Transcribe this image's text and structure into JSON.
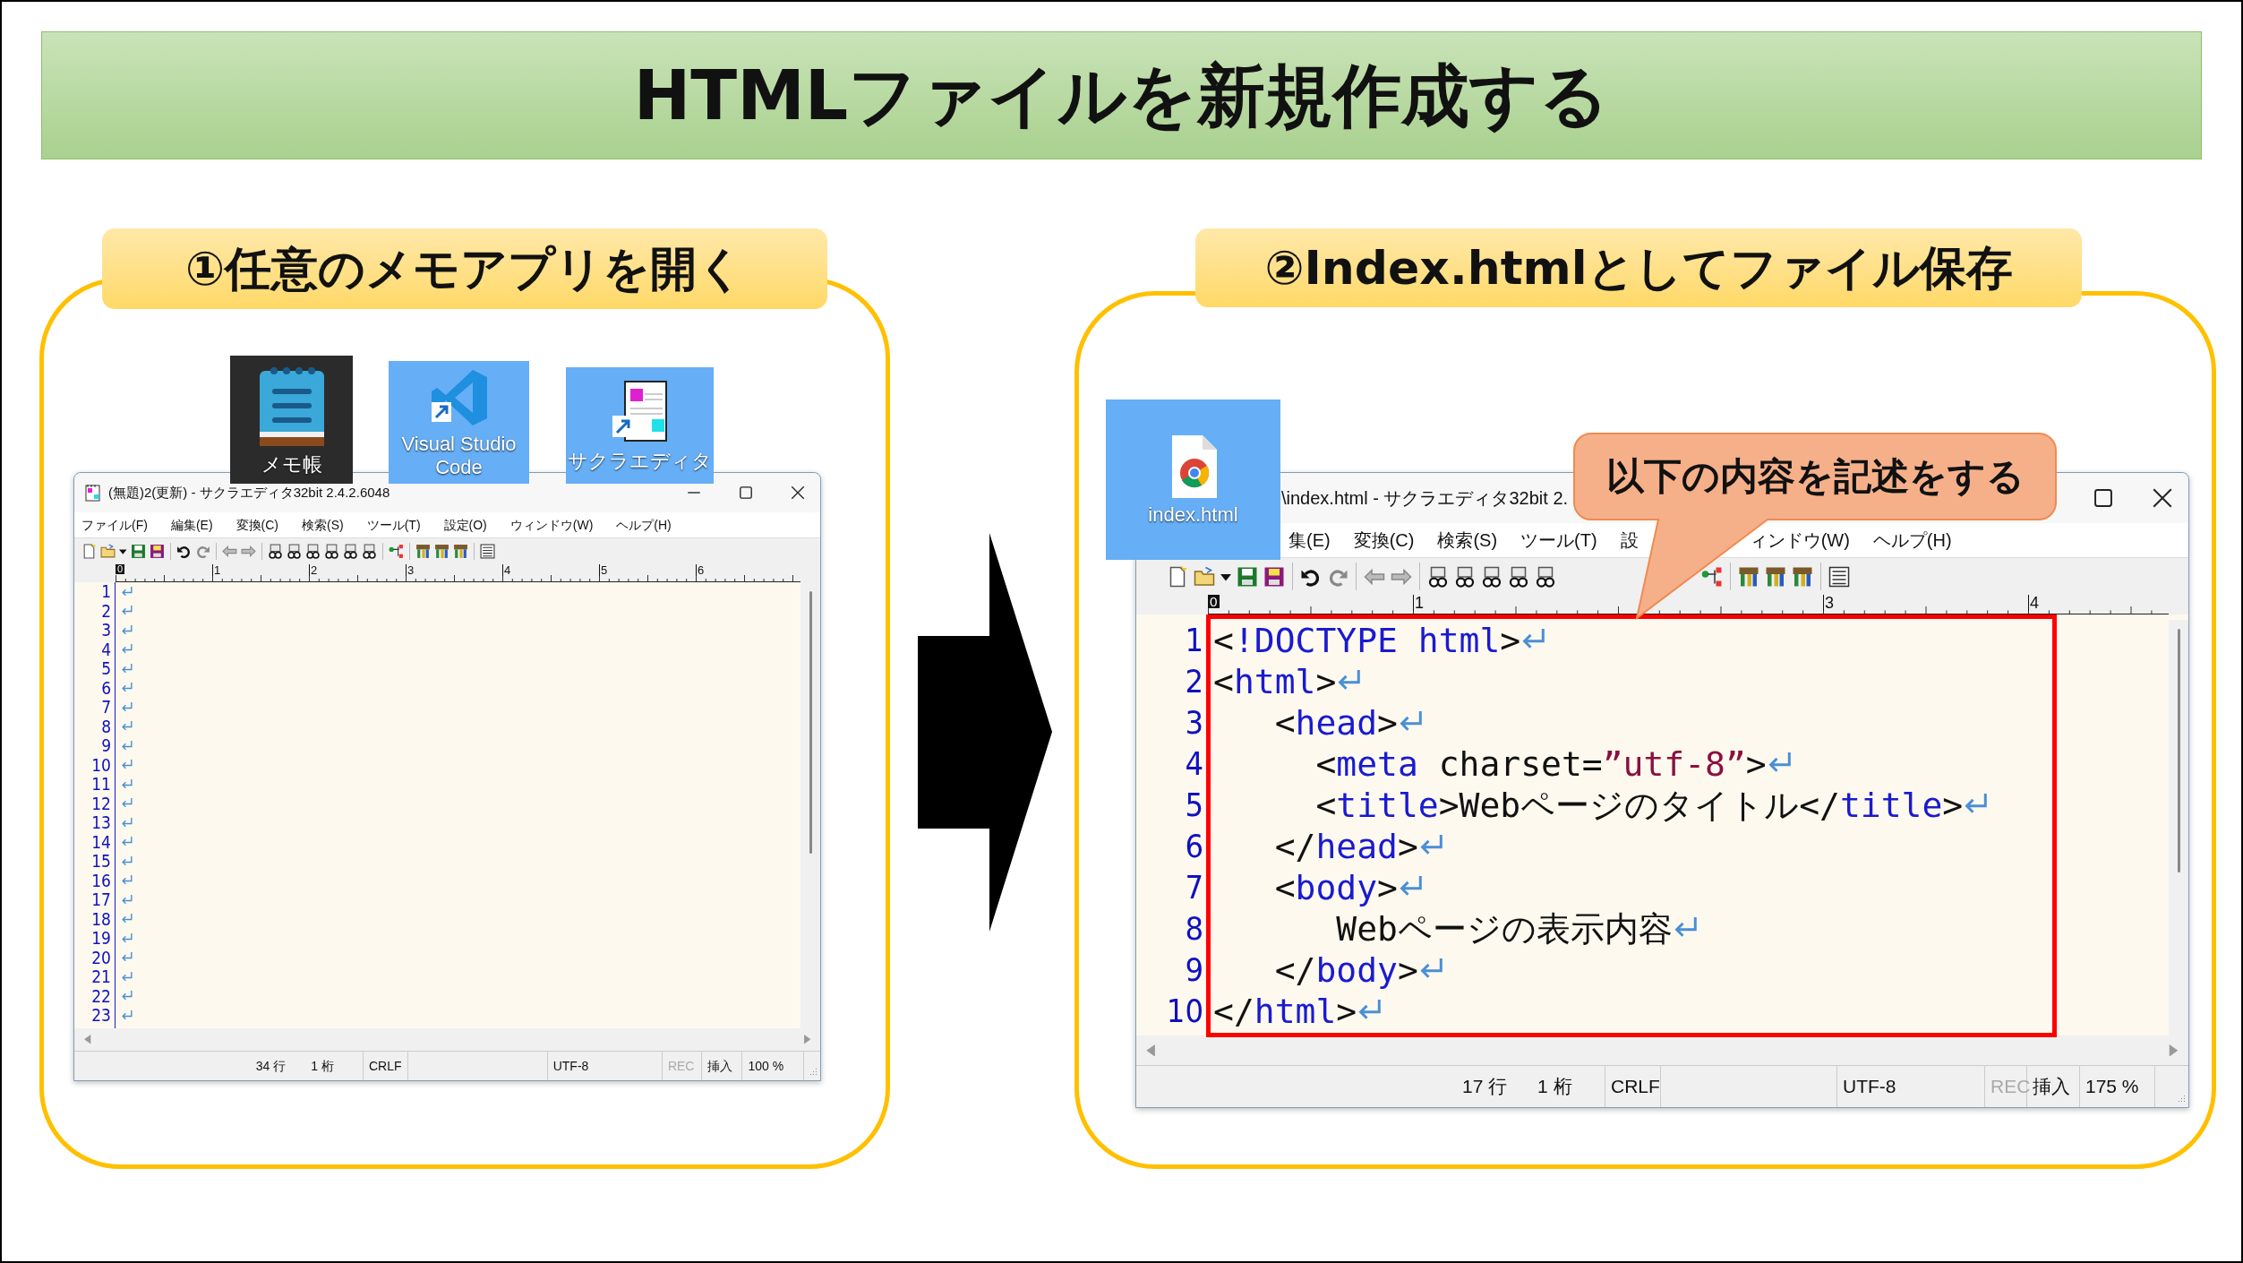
{
  "title": "HTMLファイルを新規作成する",
  "steps": [
    {
      "label": "①任意のメモアプリを開く",
      "desktop_icons": [
        {
          "kind": "notepad",
          "label": "メモ帳"
        },
        {
          "kind": "vscode",
          "label": "Visual Studio Code"
        },
        {
          "kind": "sakura",
          "label": "サクラエディタ"
        }
      ],
      "editor": {
        "title_icon": true,
        "title": "(無題)2(更新) - サクラエディタ32bit 2.4.2.6048",
        "window_buttons": [
          {
            "kind": "minimize"
          },
          {
            "kind": "maximize"
          },
          {
            "kind": "close"
          }
        ],
        "menu": [
          "ファイル(F)",
          "編集(E)",
          "変換(C)",
          "検索(S)",
          "ツール(T)",
          "設定(O)",
          "ウィンドウ(W)",
          "ヘルプ(H)"
        ],
        "cursor_label": "0",
        "ruler_marks": [
          {
            "kind": "mark",
            "label": "1"
          },
          {
            "kind": "mark",
            "label": "2"
          },
          {
            "kind": "mark",
            "label": "3"
          },
          {
            "kind": "mark",
            "label": "4"
          },
          {
            "kind": "mark",
            "label": "5"
          },
          {
            "kind": "mark",
            "label": "6"
          }
        ],
        "lines": [
          {
            "number": "1"
          },
          {
            "number": "2"
          },
          {
            "number": "3"
          },
          {
            "number": "4"
          },
          {
            "number": "5"
          },
          {
            "number": "6"
          },
          {
            "number": "7"
          },
          {
            "number": "8"
          },
          {
            "number": "9"
          },
          {
            "number": "10"
          },
          {
            "number": "11"
          },
          {
            "number": "12"
          },
          {
            "number": "13"
          },
          {
            "number": "14"
          },
          {
            "number": "15"
          },
          {
            "number": "16"
          },
          {
            "number": "17"
          },
          {
            "number": "18"
          },
          {
            "number": "19"
          },
          {
            "number": "20"
          },
          {
            "number": "21"
          },
          {
            "number": "22"
          },
          {
            "number": "23"
          }
        ],
        "status": [
          {
            "text": "34 行",
            "disabled": false
          },
          {
            "text": "1 桁",
            "disabled": false
          },
          {
            "text": "CRLF",
            "disabled": false
          },
          {
            "text": "UTF-8",
            "disabled": false
          },
          {
            "text": "REC",
            "disabled": true
          },
          {
            "text": "挿入",
            "disabled": false
          },
          {
            "text": "100 %",
            "disabled": false
          }
        ]
      }
    },
    {
      "label": "②Index.htmlとしてファイル保存",
      "desktop_icons": [
        {
          "kind": "html_file",
          "label": "index.html"
        }
      ],
      "callout": "以下の内容を記述をする",
      "editor": {
        "title_icon": false,
        "title": "\\index.html - サクラエディタ32bit 2.",
        "window_buttons": [
          {
            "kind": "maximize"
          },
          {
            "kind": "close"
          }
        ],
        "menu": [
          "集(E)",
          "変換(C)",
          "検索(S)",
          "ツール(T)",
          "設",
          "ィンドウ(W)",
          "ヘルプ(H)"
        ],
        "cursor_label": "0",
        "ruler_marks": [
          {
            "kind": "mark",
            "label": "1"
          },
          {
            "kind": "gap"
          },
          {
            "kind": "mark",
            "label": "3"
          },
          {
            "kind": "mark",
            "label": "4"
          }
        ],
        "lines": [
          {
            "number": "1",
            "segments": [
              {
                "kind": "plain",
                "text": "<"
              },
              {
                "kind": "tag",
                "text": "!DOCTYPE html"
              },
              {
                "kind": "plain",
                "text": ">"
              }
            ]
          },
          {
            "number": "2",
            "segments": [
              {
                "kind": "plain",
                "text": "<"
              },
              {
                "kind": "tag",
                "text": "html"
              },
              {
                "kind": "plain",
                "text": ">"
              }
            ]
          },
          {
            "number": "3",
            "segments": [
              {
                "kind": "plain",
                "text": "   <"
              },
              {
                "kind": "tag",
                "text": "head"
              },
              {
                "kind": "plain",
                "text": ">"
              }
            ]
          },
          {
            "number": "4",
            "segments": [
              {
                "kind": "plain",
                "text": "     <"
              },
              {
                "kind": "tag",
                "text": "meta"
              },
              {
                "kind": "plain",
                "text": " charset="
              },
              {
                "kind": "string",
                "text": "”utf-8”"
              },
              {
                "kind": "plain",
                "text": ">"
              }
            ]
          },
          {
            "number": "5",
            "segments": [
              {
                "kind": "plain",
                "text": "     <"
              },
              {
                "kind": "tag",
                "text": "title"
              },
              {
                "kind": "plain",
                "text": ">Webページのタイトル</"
              },
              {
                "kind": "tag",
                "text": "title"
              },
              {
                "kind": "plain",
                "text": ">"
              }
            ]
          },
          {
            "number": "6",
            "segments": [
              {
                "kind": "plain",
                "text": "   </"
              },
              {
                "kind": "tag",
                "text": "head"
              },
              {
                "kind": "plain",
                "text": ">"
              }
            ]
          },
          {
            "number": "7",
            "segments": [
              {
                "kind": "plain",
                "text": "   <"
              },
              {
                "kind": "tag",
                "text": "body"
              },
              {
                "kind": "plain",
                "text": ">"
              }
            ]
          },
          {
            "number": "8",
            "segments": [
              {
                "kind": "plain",
                "text": "      Webページの表示内容"
              }
            ]
          },
          {
            "number": "9",
            "segments": [
              {
                "kind": "plain",
                "text": "   </"
              },
              {
                "kind": "tag",
                "text": "body"
              },
              {
                "kind": "plain",
                "text": ">"
              }
            ]
          },
          {
            "number": "10",
            "segments": [
              {
                "kind": "plain",
                "text": "</"
              },
              {
                "kind": "tag",
                "text": "html"
              },
              {
                "kind": "plain",
                "text": ">"
              }
            ]
          }
        ],
        "status": [
          {
            "text": "17 行",
            "disabled": false
          },
          {
            "text": "1 桁",
            "disabled": false
          },
          {
            "text": "CRLF",
            "disabled": false
          },
          {
            "text": "UTF-8",
            "disabled": false
          },
          {
            "text": "REC",
            "disabled": true
          },
          {
            "text": "挿入",
            "disabled": false
          },
          {
            "text": "175 %",
            "disabled": false
          }
        ]
      }
    }
  ]
}
